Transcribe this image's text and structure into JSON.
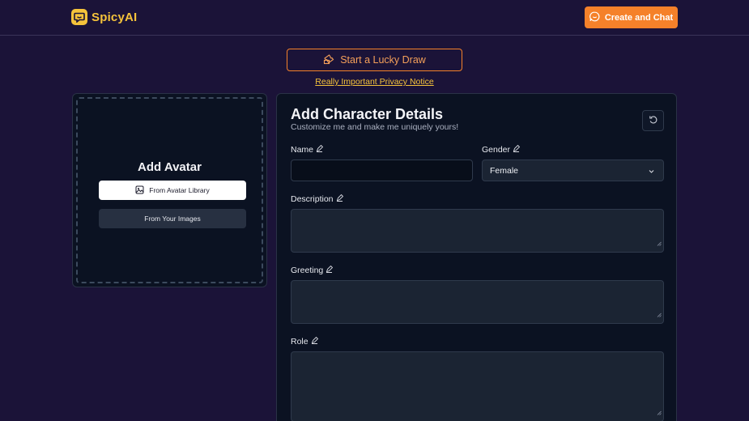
{
  "header": {
    "brand": "SpicyAI",
    "create_button": "Create and Chat"
  },
  "lucky_draw": {
    "label": "Start a Lucky Draw"
  },
  "privacy_link": "Really Important Privacy Notice",
  "avatar": {
    "title": "Add Avatar",
    "library_button": "From Avatar Library",
    "images_button": "From Your Images"
  },
  "form": {
    "title": "Add Character Details",
    "subtitle": "Customize me and make me uniquely yours!",
    "name_label": "Name",
    "name_value": "",
    "gender_label": "Gender",
    "gender_value": "Female",
    "description_label": "Description",
    "description_value": "",
    "greeting_label": "Greeting",
    "greeting_value": "",
    "role_label": "Role",
    "role_value": ""
  },
  "icons": {
    "logo": "chat-bubble-smile-icon",
    "create": "chat-bubble-icon",
    "lucky_draw": "ticket-icon",
    "library": "image-gallery-icon",
    "reset": "refresh-icon",
    "edit": "pencil-icon",
    "dropdown": "chevron-down-icon"
  },
  "colors": {
    "background": "#1b1338",
    "brand_yellow": "#f5c33b",
    "accent_orange": "#f5812a",
    "panel": "#0b1222"
  }
}
